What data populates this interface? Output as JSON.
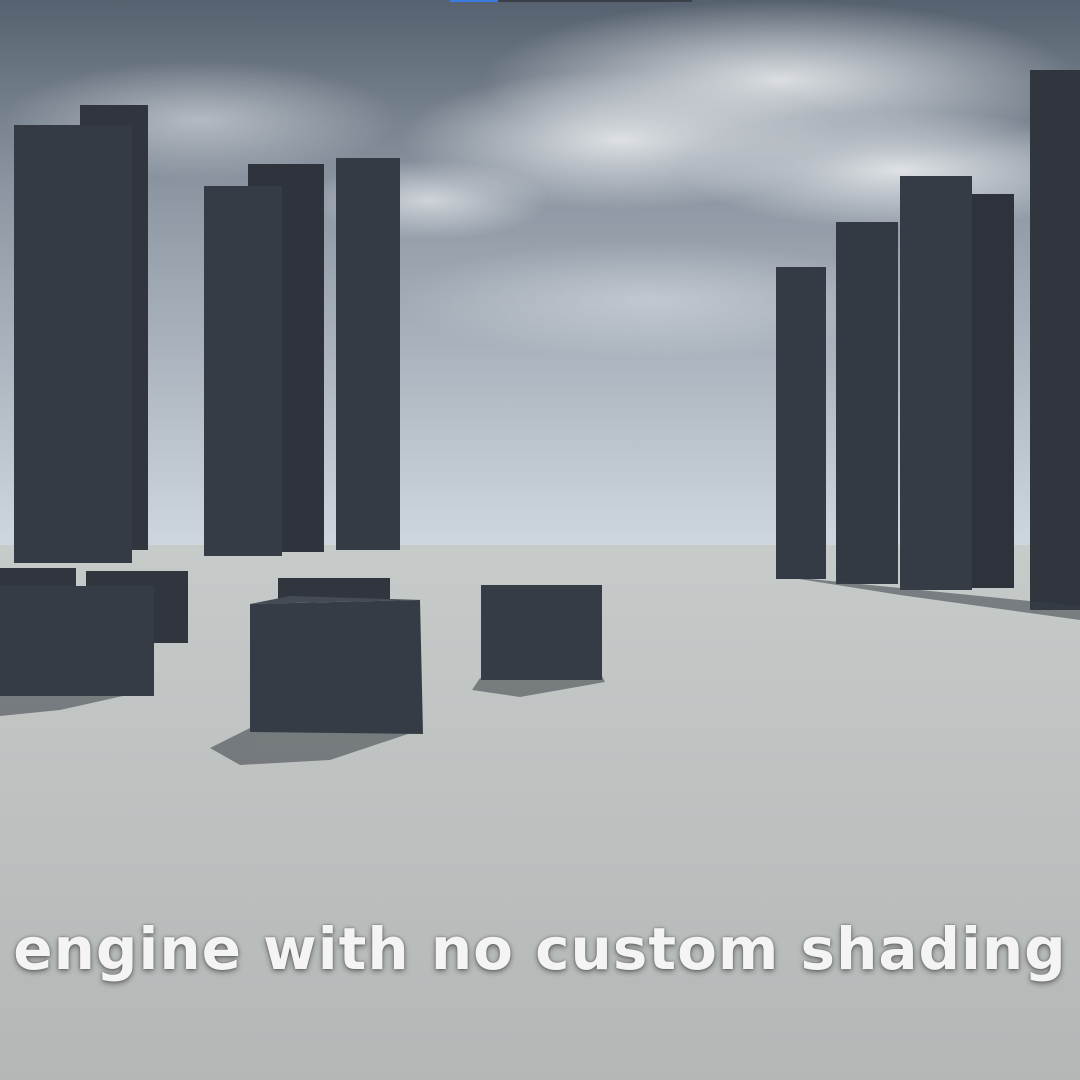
{
  "video": {
    "subtitle": "engine with no custom shading",
    "progress_fraction": 0.2
  },
  "scene": {
    "sky_top": "#55606f",
    "sky_horizon": "#c9d2db",
    "ground": "#b9bdbc",
    "building_color": "#353b44",
    "building_side": "#2b3038"
  }
}
